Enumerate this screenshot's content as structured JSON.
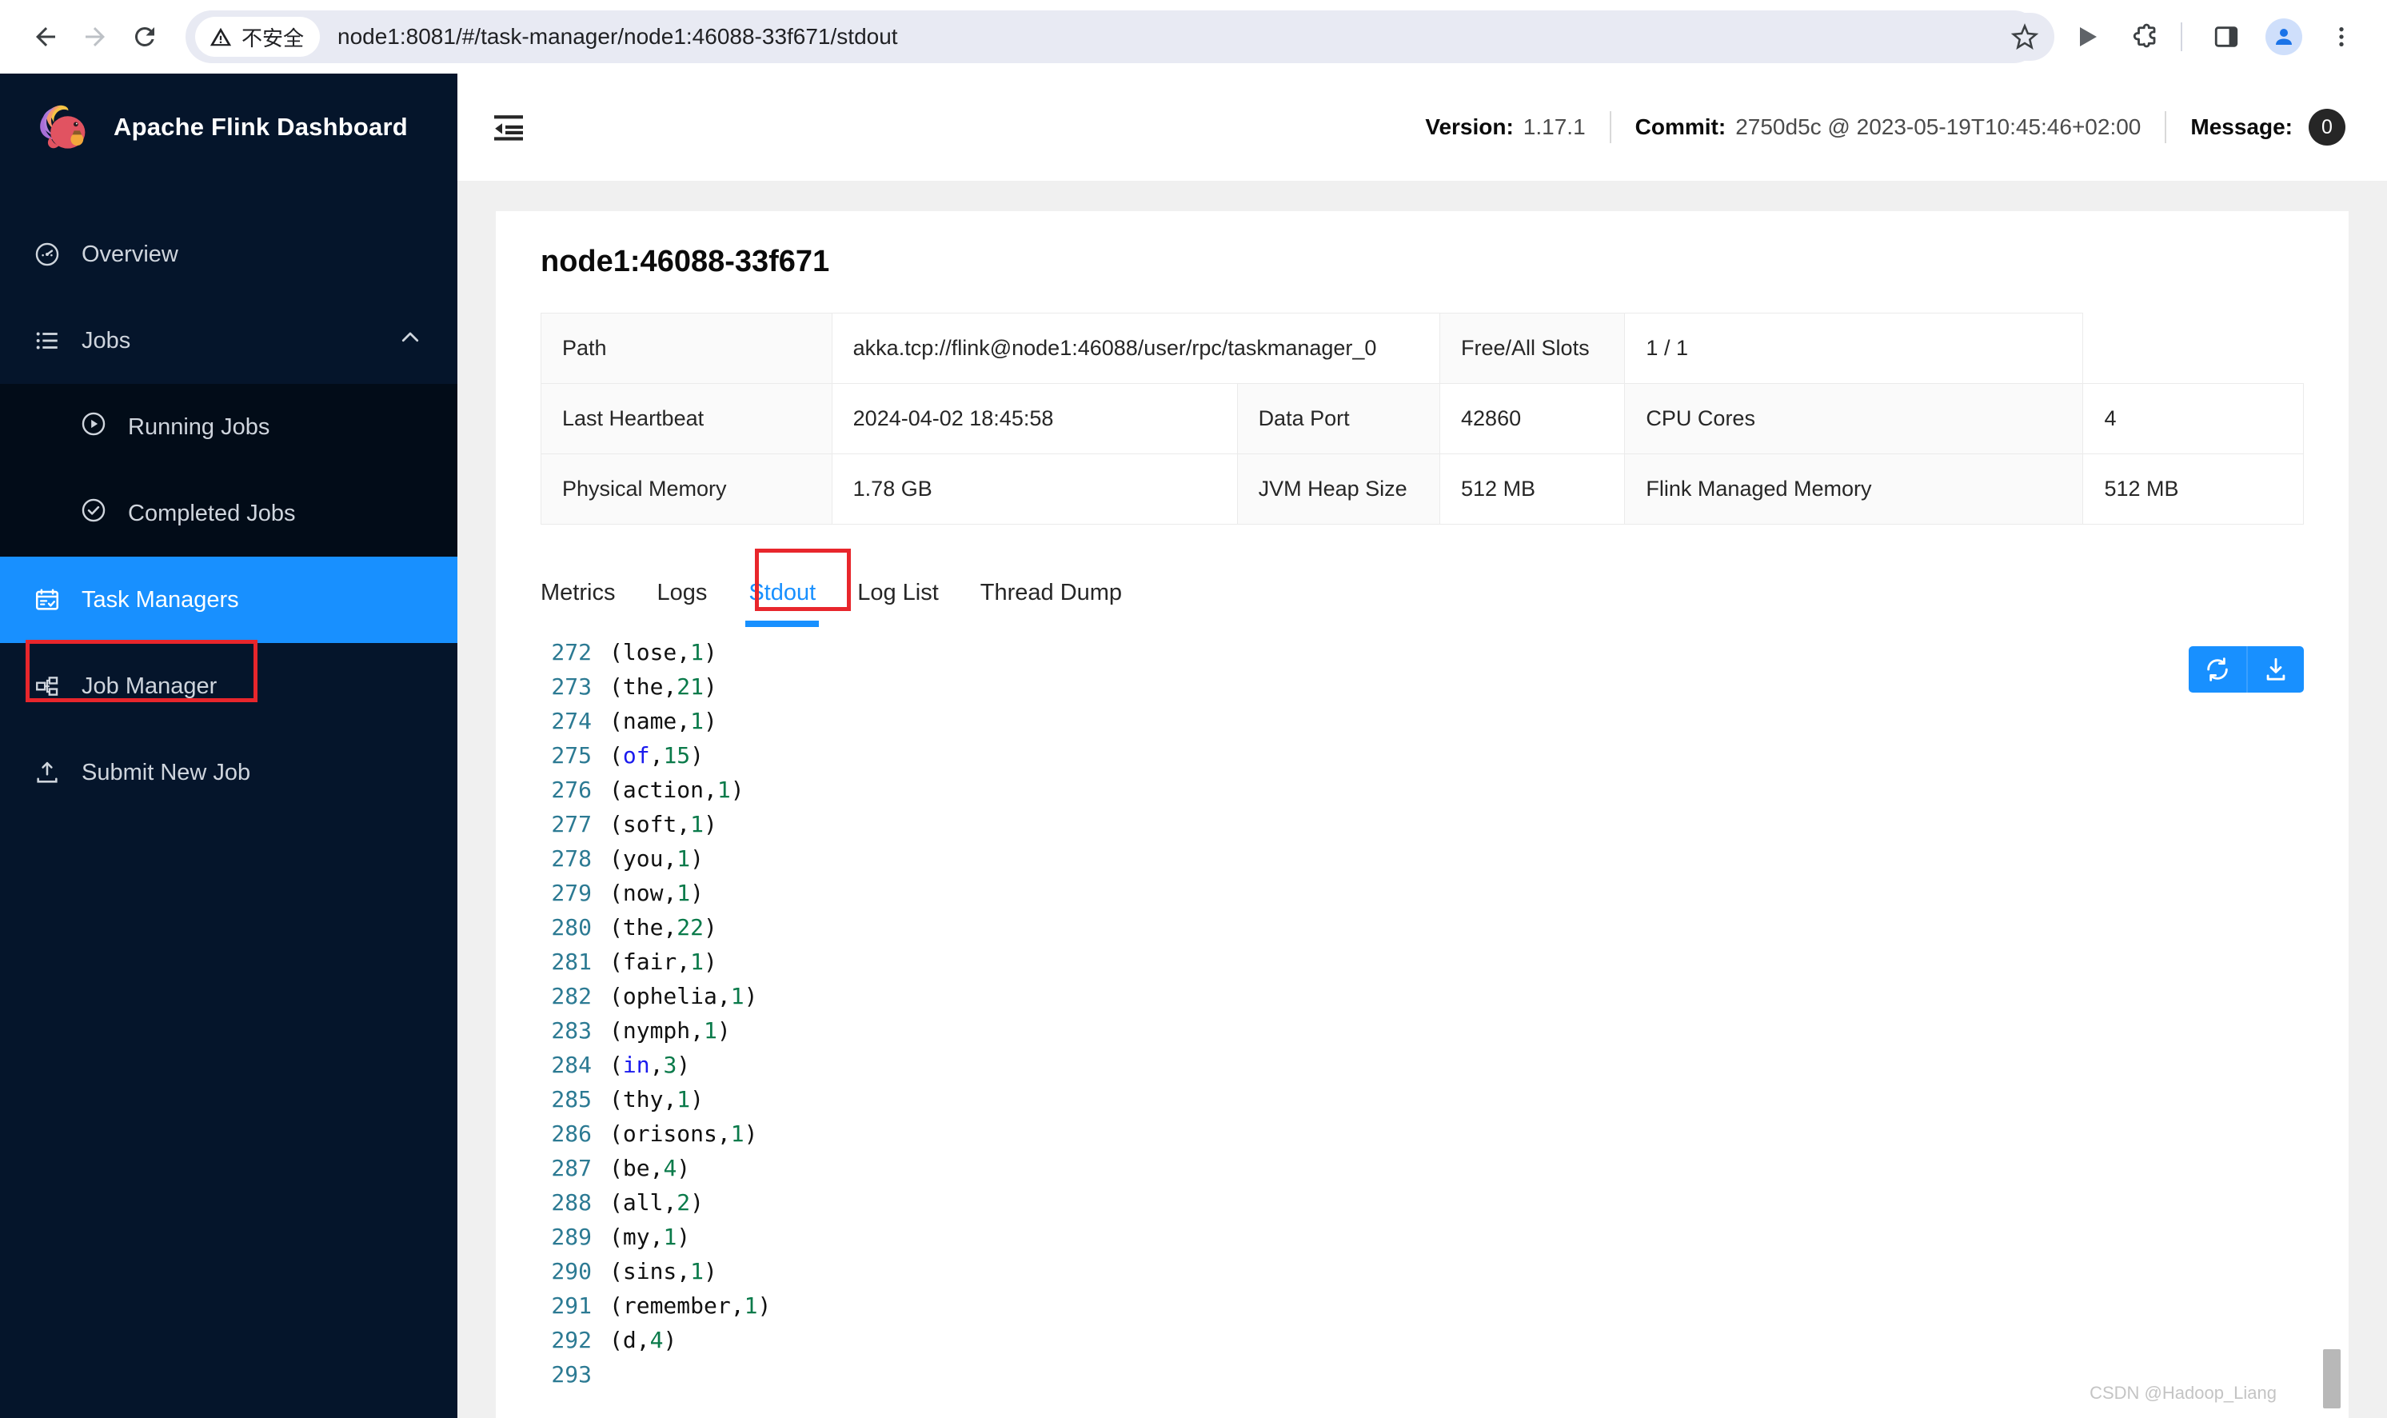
{
  "browser": {
    "back_icon": "arrow-left-icon",
    "forward_icon": "arrow-right-icon",
    "reload_icon": "reload-icon",
    "security_label": "不安全",
    "security_icon": "warning-triangle-icon",
    "url": "node1:8081/#/task-manager/node1:46088-33f671/stdout",
    "bookmark_icon": "star-icon",
    "media_icon": "play-icon",
    "extensions_icon": "puzzle-icon",
    "sidepanel_icon": "side-panel-icon",
    "profile_icon": "profile-avatar-icon",
    "menu_icon": "three-dot-menu-icon"
  },
  "sidebar": {
    "brand_title": "Apache Flink Dashboard",
    "logo_icon": "flink-squirrel-logo",
    "items": [
      {
        "label": "Overview",
        "icon": "dashboard-icon",
        "active": false
      },
      {
        "label": "Jobs",
        "icon": "list-icon",
        "active": false,
        "expanded": true,
        "chevron": "chevron-up-icon"
      },
      {
        "label": "Task Managers",
        "icon": "task-manager-icon",
        "active": true
      },
      {
        "label": "Job Manager",
        "icon": "cluster-icon",
        "active": false
      },
      {
        "label": "Submit New Job",
        "icon": "upload-icon",
        "active": false
      }
    ],
    "submenu": [
      {
        "label": "Running Jobs",
        "icon": "play-circle-icon"
      },
      {
        "label": "Completed Jobs",
        "icon": "check-circle-icon"
      }
    ],
    "accent_color": "#1890ff",
    "background_color": "#05152b",
    "annotation_color": "#e8262c"
  },
  "topbar": {
    "fold_icon": "menu-fold-icon",
    "version_key": "Version:",
    "version_value": "1.17.1",
    "commit_key": "Commit:",
    "commit_value": "2750d5c @ 2023-05-19T10:45:46+02:00",
    "message_key": "Message:",
    "message_count": "0"
  },
  "page": {
    "title": "node1:46088-33f671"
  },
  "info_table": {
    "rows": [
      {
        "cells": [
          {
            "text": "Path",
            "type": "label"
          },
          {
            "text": "akka.tcp://flink@node1:46088/user/rpc/taskmanager_0",
            "type": "value",
            "colspan": 3
          },
          {
            "text": "Free/All Slots",
            "type": "label"
          },
          {
            "text": "1 / 1",
            "type": "value"
          }
        ]
      },
      {
        "cells": [
          {
            "text": "Last Heartbeat",
            "type": "label"
          },
          {
            "text": "2024-04-02 18:45:58",
            "type": "value",
            "colspan": 2
          },
          {
            "text": "Data Port",
            "type": "label"
          },
          {
            "text": "42860",
            "type": "value"
          },
          {
            "text": "CPU Cores",
            "type": "label"
          },
          {
            "text": "4",
            "type": "value"
          }
        ]
      },
      {
        "cells": [
          {
            "text": "Physical Memory",
            "type": "label"
          },
          {
            "text": "1.78 GB",
            "type": "value",
            "colspan": 2
          },
          {
            "text": "JVM Heap Size",
            "type": "label"
          },
          {
            "text": "512 MB",
            "type": "value"
          },
          {
            "text": "Flink Managed Memory",
            "type": "label"
          },
          {
            "text": "512 MB",
            "type": "value"
          }
        ]
      }
    ]
  },
  "tabs": [
    {
      "label": "Metrics",
      "active": false
    },
    {
      "label": "Logs",
      "active": false
    },
    {
      "label": "Stdout",
      "active": true,
      "annotated": true
    },
    {
      "label": "Log List",
      "active": false
    },
    {
      "label": "Thread Dump",
      "active": false
    }
  ],
  "log_panel": {
    "refresh_icon": "refresh-icon",
    "download_icon": "download-icon",
    "watermark": "CSDN @Hadoop_Liang",
    "lines": [
      {
        "n": "272",
        "word": "lose",
        "count": "1",
        "keyword": false
      },
      {
        "n": "273",
        "word": "the",
        "count": "21",
        "keyword": false
      },
      {
        "n": "274",
        "word": "name",
        "count": "1",
        "keyword": false
      },
      {
        "n": "275",
        "word": "of",
        "count": "15",
        "keyword": true
      },
      {
        "n": "276",
        "word": "action",
        "count": "1",
        "keyword": false
      },
      {
        "n": "277",
        "word": "soft",
        "count": "1",
        "keyword": false
      },
      {
        "n": "278",
        "word": "you",
        "count": "1",
        "keyword": false
      },
      {
        "n": "279",
        "word": "now",
        "count": "1",
        "keyword": false
      },
      {
        "n": "280",
        "word": "the",
        "count": "22",
        "keyword": false
      },
      {
        "n": "281",
        "word": "fair",
        "count": "1",
        "keyword": false
      },
      {
        "n": "282",
        "word": "ophelia",
        "count": "1",
        "keyword": false
      },
      {
        "n": "283",
        "word": "nymph",
        "count": "1",
        "keyword": false
      },
      {
        "n": "284",
        "word": "in",
        "count": "3",
        "keyword": true
      },
      {
        "n": "285",
        "word": "thy",
        "count": "1",
        "keyword": false
      },
      {
        "n": "286",
        "word": "orisons",
        "count": "1",
        "keyword": false
      },
      {
        "n": "287",
        "word": "be",
        "count": "4",
        "keyword": false
      },
      {
        "n": "288",
        "word": "all",
        "count": "2",
        "keyword": false
      },
      {
        "n": "289",
        "word": "my",
        "count": "1",
        "keyword": false
      },
      {
        "n": "290",
        "word": "sins",
        "count": "1",
        "keyword": false
      },
      {
        "n": "291",
        "word": "remember",
        "count": "1",
        "keyword": false
      },
      {
        "n": "292",
        "word": "d",
        "count": "4",
        "keyword": false
      },
      {
        "n": "293",
        "word": "",
        "count": "",
        "keyword": false
      }
    ]
  }
}
